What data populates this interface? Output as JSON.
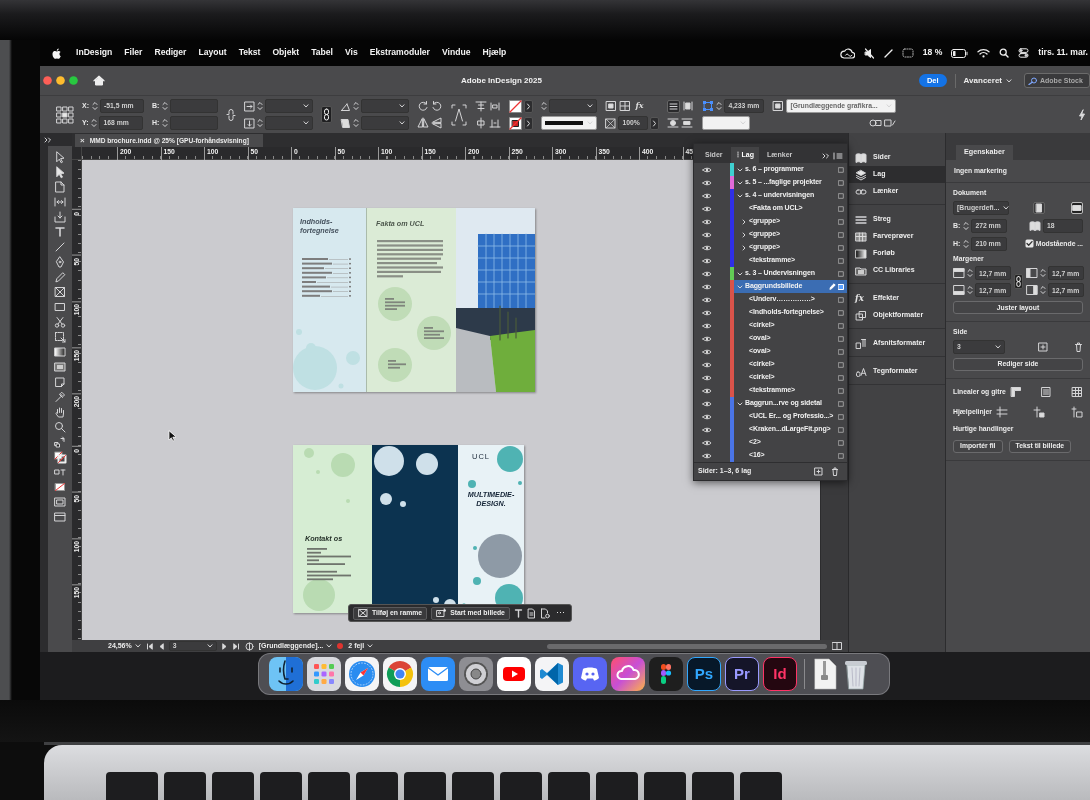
{
  "menu_bar": {
    "app": "InDesign",
    "menus": [
      "Filer",
      "Rediger",
      "Layout",
      "Tekst",
      "Objekt",
      "Tabel",
      "Vis",
      "Ekstramoduler",
      "Vindue",
      "Hjælp"
    ],
    "battery": "18 %",
    "clock": "tirs. 11. mar."
  },
  "window": {
    "title": "Adobe InDesign 2025",
    "share": "Del",
    "workspace": "Avanceret",
    "stock_search": {
      "placeholder": "Adobe Stock"
    }
  },
  "control_bar": {
    "x": {
      "label": "X:",
      "value": "-51,5 mm"
    },
    "y": {
      "label": "Y:",
      "value": "168 mm"
    },
    "w": {
      "label": "B:"
    },
    "h": {
      "label": "H:"
    },
    "effects": "fx",
    "opacity": "100%",
    "spacing": "4,233 mm",
    "object_style": "[Grundlæggende grafikra..."
  },
  "document_tab": {
    "close": "×",
    "title": "MMD brochure.indd @ 25% [GPU-forhåndsvisning]"
  },
  "rulers": {
    "horizontal": [
      "200",
      "150",
      "100",
      "50",
      "0",
      "50",
      "100",
      "150",
      "200",
      "250",
      "300",
      "350",
      "400",
      "45"
    ],
    "vertical": [
      [
        "0",
        "50",
        "100",
        "150",
        "200"
      ],
      [
        "0",
        "50",
        "100",
        "150"
      ]
    ]
  },
  "spreads": [
    {
      "panels": [
        {
          "kind": "contents",
          "title": "Indholds-fortegnelse"
        },
        {
          "kind": "facts",
          "title": "Fakta om UCL"
        },
        {
          "kind": "photo"
        }
      ]
    },
    {
      "panels": [
        {
          "kind": "contact",
          "title": "Kontakt os"
        },
        {
          "kind": "dark"
        },
        {
          "kind": "cover",
          "logo": "UCL",
          "headline": "MULTIMEDIE-DESIGN."
        }
      ]
    }
  ],
  "task_bar": {
    "buttons": [
      {
        "kind": "frame",
        "label": "Tilføj en ramme"
      },
      {
        "kind": "image",
        "label": "Start med billede"
      }
    ],
    "more": "⋯"
  },
  "status_bar": {
    "zoom": "24,56%",
    "page": "3",
    "style": "[Grundlæggende]...",
    "has_errors": true,
    "errors": "2 fejl"
  },
  "layers_panel": {
    "tabs": [
      {
        "label": "Sider",
        "selected": false
      },
      {
        "label": "Lag",
        "selected": true
      },
      {
        "label": "Lænker",
        "selected": false
      }
    ],
    "layers": [
      {
        "name": "s. 6 – programmer",
        "color": "#3fd0d0",
        "visible": true,
        "expanded": true,
        "selected": false
      },
      {
        "name": "s. 5 – ...faglige projekter",
        "color": "#e06ad8",
        "visible": true,
        "expanded": true,
        "selected": false
      },
      {
        "name": "s. 4 – undervisningen",
        "color": "#2f2fe6",
        "visible": true,
        "expanded": true,
        "selected": false,
        "children": [
          {
            "name": "<Fakta om UCL>",
            "kind": "object",
            "visible": true
          },
          {
            "name": "<gruppe>",
            "kind": "group",
            "expanded": false,
            "visible": true
          },
          {
            "name": "<gruppe>",
            "kind": "group",
            "expanded": false,
            "visible": true
          },
          {
            "name": "<gruppe>",
            "kind": "group",
            "expanded": false,
            "visible": true
          },
          {
            "name": "<tekstramme>",
            "kind": "object",
            "visible": true
          }
        ]
      },
      {
        "name": "s. 3 – Undervisningen",
        "color": "#63cc55",
        "visible": true,
        "expanded": true,
        "selected": false
      },
      {
        "name": "Baggrundsbillede",
        "color": "#d9534a",
        "visible": true,
        "expanded": true,
        "selected": true,
        "children": [
          {
            "name": "<Underv……………>",
            "kind": "object",
            "visible": true
          },
          {
            "name": "<Indholds-fortegnelse>",
            "kind": "object",
            "visible": true
          },
          {
            "name": "<cirkel>",
            "kind": "object",
            "visible": true
          },
          {
            "name": "<oval>",
            "kind": "object",
            "visible": true
          },
          {
            "name": "<oval>",
            "kind": "object",
            "visible": true
          },
          {
            "name": "<cirkel>",
            "kind": "object",
            "visible": true
          },
          {
            "name": "<cirkel>",
            "kind": "object",
            "visible": true
          },
          {
            "name": "<tekstramme>",
            "kind": "object",
            "visible": true
          }
        ]
      },
      {
        "name": "Baggrun...rve og sidetal",
        "color": "#4a74e6",
        "visible": true,
        "expanded": true,
        "selected": false,
        "children": [
          {
            "name": "<UCL Er... og Professio...>",
            "kind": "object",
            "visible": true
          },
          {
            "name": "<Kraken...dLargeFit.png>",
            "kind": "object",
            "visible": true
          },
          {
            "name": "<2>",
            "kind": "object",
            "visible": true
          },
          {
            "name": "<16>",
            "kind": "object",
            "visible": true
          }
        ]
      }
    ],
    "footer": "Sider: 1–3, 6 lag"
  },
  "panel_dock": {
    "groups": [
      {
        "items": [
          {
            "kind": "pages",
            "label": "Sider",
            "selected": false
          },
          {
            "kind": "layers",
            "label": "Lag",
            "selected": true
          },
          {
            "kind": "links",
            "label": "Lænker",
            "selected": false
          }
        ]
      },
      {
        "items": [
          {
            "kind": "stroke",
            "label": "Streg",
            "selected": false
          },
          {
            "kind": "swatches",
            "label": "Farveprøver",
            "selected": false
          },
          {
            "kind": "gradient",
            "label": "Forløb",
            "selected": false
          },
          {
            "kind": "libraries",
            "label": "CC Libraries",
            "selected": false
          }
        ]
      },
      {
        "items": [
          {
            "kind": "effects",
            "glyph": "fx",
            "label": "Effekter",
            "selected": false
          },
          {
            "kind": "object_styles",
            "label": "Objektformater",
            "selected": false
          }
        ]
      },
      {
        "items": [
          {
            "kind": "paragraph_styles",
            "label": "Afsnitsformater",
            "selected": false
          }
        ]
      },
      {
        "items": [
          {
            "kind": "character_styles",
            "label": "Tegnformater",
            "selected": false
          }
        ]
      }
    ]
  },
  "properties": {
    "tab": "Egenskaber",
    "selection": "Ingen markering",
    "document": {
      "heading": "Dokument",
      "preset": "[Brugerdefi...",
      "orientations": [
        {
          "kind": "portrait",
          "selected": false
        },
        {
          "kind": "landscape",
          "selected": true
        }
      ],
      "width": {
        "label": "B:",
        "value": "272 mm"
      },
      "height": {
        "label": "H:",
        "value": "210 mm"
      },
      "pages": "18",
      "facing_pages": {
        "label": "Modstående ...",
        "checked": true
      }
    },
    "margins": {
      "heading": "Margener",
      "fields": [
        {
          "kind": "top",
          "value": "12,7 mm"
        },
        {
          "kind": "bottom",
          "value": "12,7 mm"
        },
        {
          "kind": "left",
          "value": "12,7 mm"
        },
        {
          "kind": "right",
          "value": "12,7 mm"
        }
      ],
      "button": "Juster layout"
    },
    "page": {
      "heading": "Side",
      "value": "3",
      "button": "Rediger side"
    },
    "rulers_grids": "Linealer og gitre",
    "guides": "Hjælpelinjer",
    "quick_actions": {
      "heading": "Hurtige handlinger",
      "buttons": [
        "Importér fil",
        "Tekst til billede"
      ]
    }
  },
  "dock": {
    "lettered_apps": [
      {
        "label": "Ps",
        "color": "#31a8ff"
      },
      {
        "label": "Pr",
        "color": "#9999ff"
      },
      {
        "label": "Id",
        "color": "#ff3366"
      }
    ]
  }
}
